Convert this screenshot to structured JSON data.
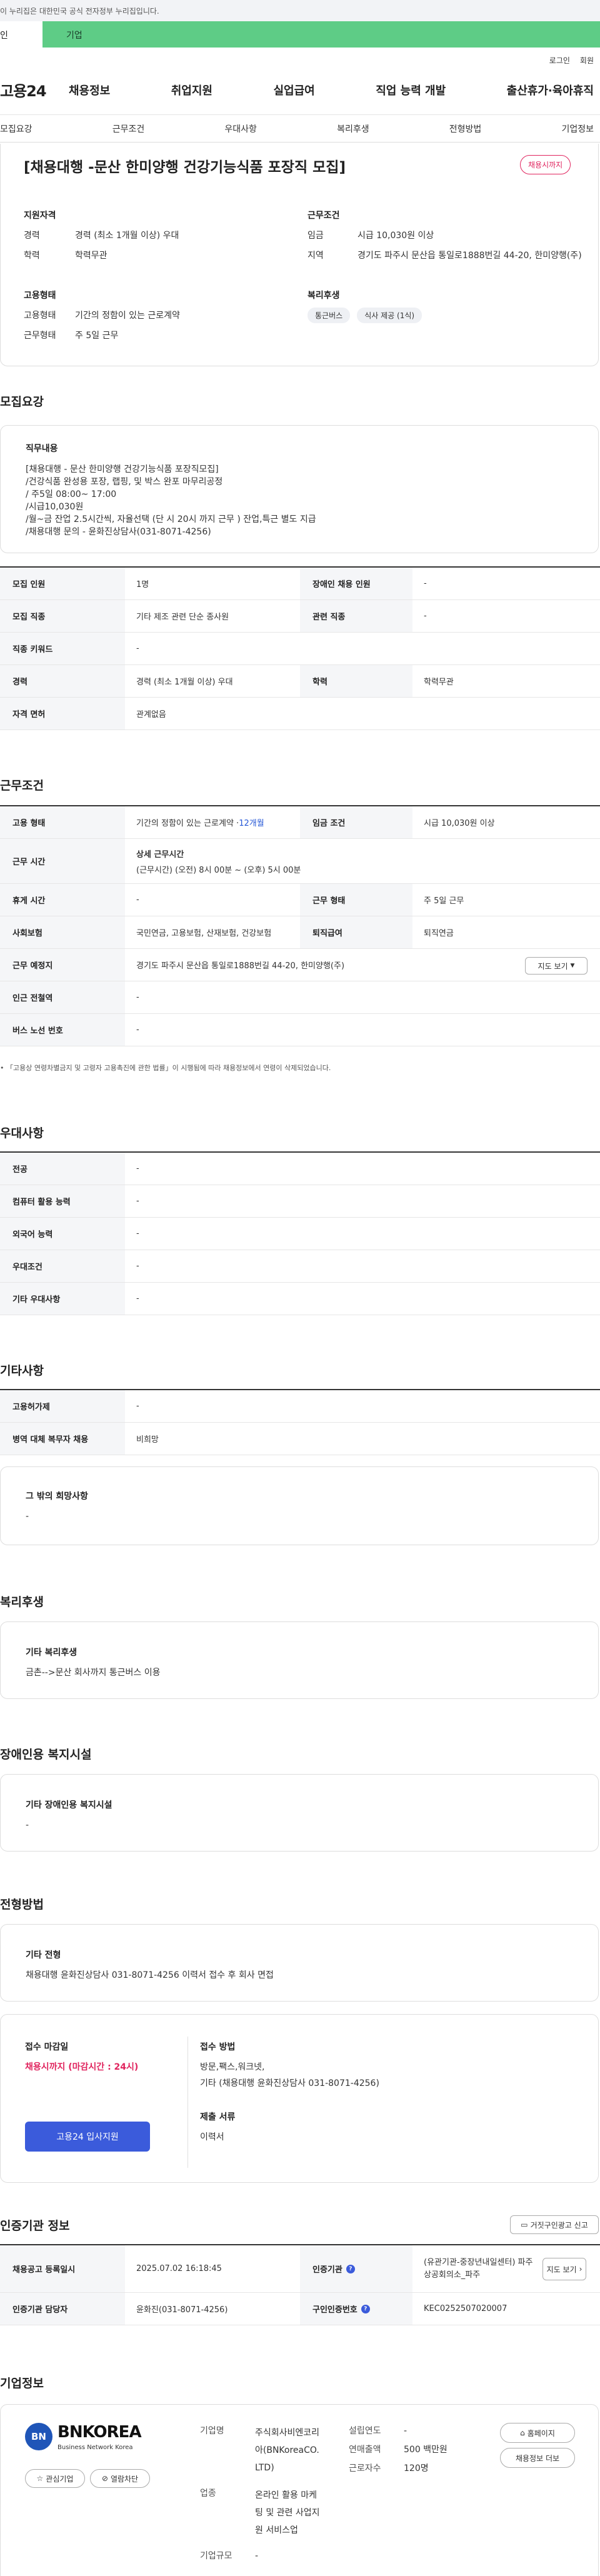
{
  "gov": {
    "notice": "이 누리집은 대한민국 공식 전자정부 누리집입니다."
  },
  "tabs": {
    "individual": "인",
    "enterprise": "기업"
  },
  "util": {
    "login": "로그인",
    "join": "회원"
  },
  "gnb": {
    "logo": "고용24",
    "items": [
      "채용정보",
      "취업지원",
      "실업급여",
      "직업 능력 개발",
      "출산휴가·육아휴직"
    ]
  },
  "subnav": [
    "모집요강",
    "근무조건",
    "우대사항",
    "복리후생",
    "전형방법",
    "기업정보"
  ],
  "header": {
    "title": "[채용대행 -문산 한미양행 건강기능식품 포장직 모집]",
    "badge": "채용시까지",
    "qual_h": "지원자격",
    "career_l": "경력",
    "career_v": "경력 (최소 1개월 이상) 우대",
    "edu_l": "학력",
    "edu_v": "학력무관",
    "emp_h": "고용형태",
    "emptype_l": "고용형태",
    "emptype_v": "기간의 정함이 있는 근로계약",
    "worktype_l": "근무형태",
    "worktype_v": "주 5일 근무",
    "cond_h": "근무조건",
    "wage_l": "임금",
    "wage_v": "시급 10,030원 이상",
    "area_l": "지역",
    "area_v": "경기도 파주시 문산읍 통일로1888번길 44-20, 한미양행(주)",
    "welfare_h": "복리후생",
    "welfare_pills": [
      "통근버스",
      "식사 제공 (1식)"
    ]
  },
  "recruit": {
    "heading": "모집요강",
    "duty_h": "직무내용",
    "duty_lines": [
      "[채용대행 - 문산 한미양행 건강기능식품 포장직모집]",
      "/건강식품 완성용 포장, 랩핑, 및 박스 완포 마무리공정",
      "/ 주5일 08:00~ 17:00",
      "/시급10,030원",
      "/월~금 잔업 2.5시간씩, 자율선택 (단 시 20시 까지 근무 ) 잔업,특근 별도 지급",
      "/채용대행 문의 - 윤화진상담사(031-8071-4256)"
    ],
    "rows": [
      [
        "모집 인원",
        "1명",
        "장애인 채용 인원",
        "-"
      ],
      [
        "모집 직종",
        "기타 제조 관련 단순 종사원",
        "관련 직종",
        "-"
      ],
      [
        "직종 키워드",
        "-"
      ],
      [
        "경력",
        "경력 (최소 1개월 이상) 우대",
        "학력",
        "학력무관"
      ],
      [
        "자격 면허",
        "관계없음"
      ]
    ]
  },
  "work": {
    "heading": "근무조건",
    "emp_l": "고용 형태",
    "emp_v": "기간의 정함이 있는 근로계약 · ",
    "emp_months": "12개월",
    "wage_l": "임금 조건",
    "wage_v": "시급 10,030원 이상",
    "time_l": "근무 시간",
    "time_h": "상세 근무시간",
    "time_v": "(근무시간) (오전) 8시 00분 ~ (오후) 5시 00분",
    "rest_l": "휴게 시간",
    "rest_v": "-",
    "form_l": "근무 형태",
    "form_v": "주 5일 근무",
    "ins_l": "사회보험",
    "ins_v": "국민연금, 고용보험, 산재보험, 건강보험",
    "sev_l": "퇴직급여",
    "sev_v": "퇴직연금",
    "place_l": "근무 예정지",
    "place_v": "경기도 파주시 문산읍 통일로1888번길 44-20, 한미양행(주)",
    "map_btn": "지도 보기",
    "subway_l": "인근 전철역",
    "subway_v": "-",
    "bus_l": "버스 노선 번호",
    "bus_v": "-",
    "notice": "「고용상 연령차별금지 및 고령자 고용촉진에 관한 법률」이 시행됨에 따라 채용정보에서 연령이 삭제되었습니다."
  },
  "pref": {
    "heading": "우대사항",
    "rows": [
      [
        "전공",
        "-"
      ],
      [
        "컴퓨터 활용 능력",
        "-"
      ],
      [
        "외국어 능력",
        "-"
      ],
      [
        "우대조건",
        "-"
      ],
      [
        "기타 우대사항",
        "-"
      ]
    ]
  },
  "etc": {
    "heading": "기타사항",
    "rows": [
      [
        "고용허가제",
        "-"
      ],
      [
        "병역 대체 복무자 채용",
        "비희망"
      ]
    ],
    "wish_h": "그 밖의 희망사항",
    "wish_v": "-"
  },
  "welfare": {
    "heading": "복리후생",
    "h": "기타 복리후생",
    "v": "금촌-->문산 회사까지 통근버스 이용"
  },
  "disabled": {
    "heading": "장애인용 복지시설",
    "h": "기타 장애인용 복지시설",
    "v": "-"
  },
  "screening": {
    "heading": "전형방법",
    "h": "기타 전형",
    "v": "채용대행 윤화진상담사 031-8071-4256 이력서 접수 후 회사 면접",
    "deadline_h": "접수 마감일",
    "deadline_v": "채용시까지 (마감시간 : 24시)",
    "method_h": "접수 방법",
    "method_v1": "방문,팩스,워크넷,",
    "method_v2": "기타 (채용대행 윤화진상담사 031-8071-4256)",
    "docs_h": "제출 서류",
    "docs_v": "이력서",
    "apply_btn": "고용24 입사지원"
  },
  "cert": {
    "heading": "인증기관 정보",
    "report_btn": "거짓구인광고 신고",
    "r1": [
      "채용공고 등록일시",
      "2025.07.02 16:18:45",
      "인증기관",
      "(유관기관-중장년내일센터) 파주상공회의소_파주"
    ],
    "map_btn": "지도 보기",
    "r2": [
      "인증기관 담당자",
      "윤화진(031-8071-4256)",
      "구인인증번호",
      "KEC0252507020007"
    ]
  },
  "company": {
    "heading": "기업정보",
    "logo_text": "BNKOREA",
    "logo_sub": "Business Network Korea",
    "fav_btn": "관심기업",
    "block_btn": "열람차단",
    "name_l": "기업명",
    "name_v1": "주식회사비엔코리",
    "name_v2": "아(BNKoreaCO.",
    "name_v3": "LTD)",
    "industry_l": "업종",
    "industry_v1": "온라인 활용 마케",
    "industry_v2": "팅 및 관련 사업지",
    "industry_v3": "원 서비스업",
    "size_l": "기업규모",
    "size_v": "-",
    "year_l": "설립연도",
    "year_v": "-",
    "sales_l": "연매출액",
    "sales_v": "500 백만원",
    "emp_l": "근로자수",
    "emp_v": "120명",
    "home_btn": "홈페이지",
    "info_btn": "채용정보 더보"
  }
}
